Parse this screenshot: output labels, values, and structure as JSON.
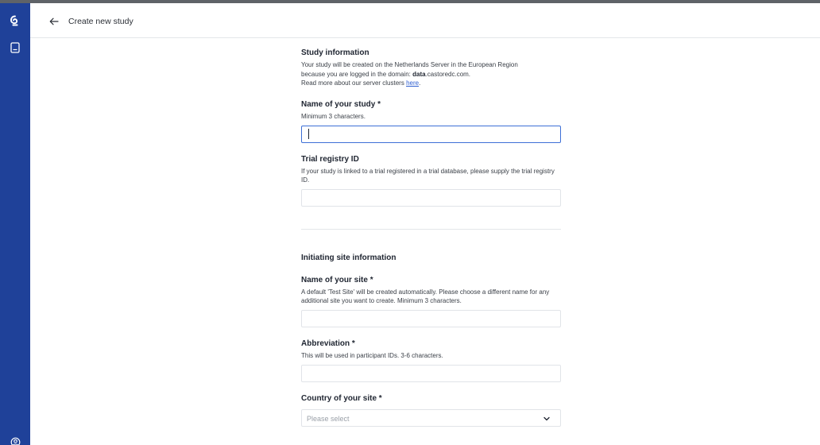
{
  "header": {
    "title": "Create new study"
  },
  "sidebar": {
    "logo_icon": "castor-logo-icon",
    "studies_icon": "studies-book-icon",
    "account_icon": "user-account-icon"
  },
  "study_info": {
    "title": "Study information",
    "line1": "Your study will be created on the Netherlands Server in the European Region",
    "line2_prefix": "because you are logged in the domain: ",
    "line2_domain_bold": "data",
    "line2_domain_rest": ".castoredc.com.",
    "line3_prefix": "Read more about our server clusters ",
    "line3_link": "here",
    "line3_suffix": "."
  },
  "study_name": {
    "label": "Name of your study *",
    "hint": "Minimum 3 characters.",
    "value": "",
    "placeholder": ""
  },
  "trial_registry": {
    "label": "Trial registry ID",
    "hint": "If your study is linked to a trial registered in a trial database, please supply the trial registry ID.",
    "value": ""
  },
  "site_info": {
    "title": "Initiating site information"
  },
  "site_name": {
    "label": "Name of your site *",
    "hint": "A default 'Test Site' will be created automatically. Please choose a different name for any additional site you want to create. Minimum 3 characters.",
    "value": ""
  },
  "abbreviation": {
    "label": "Abbreviation *",
    "hint": "This will be used in participant IDs. 3-6 characters.",
    "value": ""
  },
  "country": {
    "label": "Country of your site *",
    "placeholder": "Please select"
  },
  "colors": {
    "sidebar": "#1f4199",
    "focus_border": "#3d6fd6",
    "link": "#2f5fd0"
  }
}
